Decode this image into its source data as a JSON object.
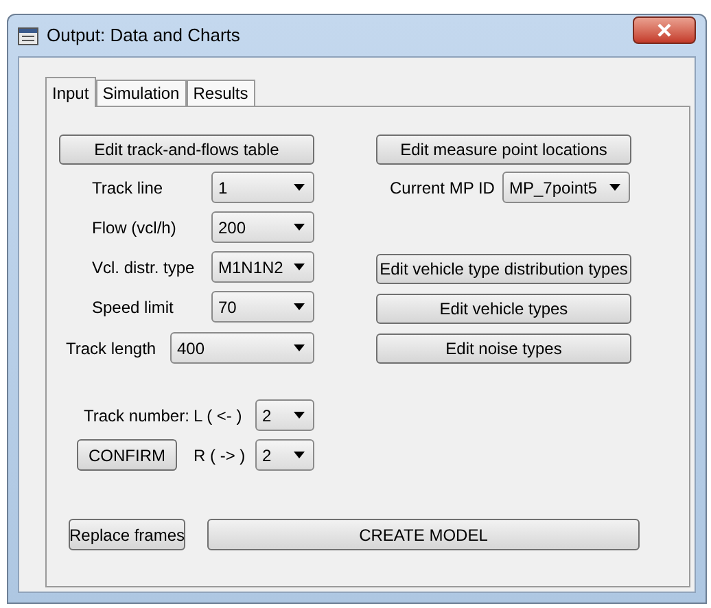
{
  "window": {
    "title": "Output: Data and Charts"
  },
  "tabs": [
    {
      "label": "Input",
      "selected": true
    },
    {
      "label": "Simulation",
      "selected": false
    },
    {
      "label": "Results",
      "selected": false
    }
  ],
  "left": {
    "button": "Edit track-and-flows table",
    "fields": [
      {
        "label": "Track line",
        "value": "1"
      },
      {
        "label": "Flow (vcl/h)",
        "value": "200"
      },
      {
        "label": "Vcl. distr. type",
        "value": "M1N1N2"
      },
      {
        "label": "Speed limit",
        "value": "70"
      }
    ],
    "track_length": {
      "label": "Track length",
      "value": "400"
    }
  },
  "right": {
    "button": "Edit measure point locations",
    "mp": {
      "label": "Current MP ID",
      "value": "MP_7point5"
    },
    "buttons": [
      "Edit vehicle type distribution types",
      "Edit vehicle types",
      "Edit noise types"
    ]
  },
  "track_number": {
    "label": "Track number:",
    "left": {
      "label": "L ( <- )",
      "value": "2"
    },
    "right": {
      "label": "R ( -> )",
      "value": "2"
    }
  },
  "confirm": "CONFIRM",
  "bottom_buttons": [
    "Replace frames",
    "CREATE MODEL"
  ]
}
